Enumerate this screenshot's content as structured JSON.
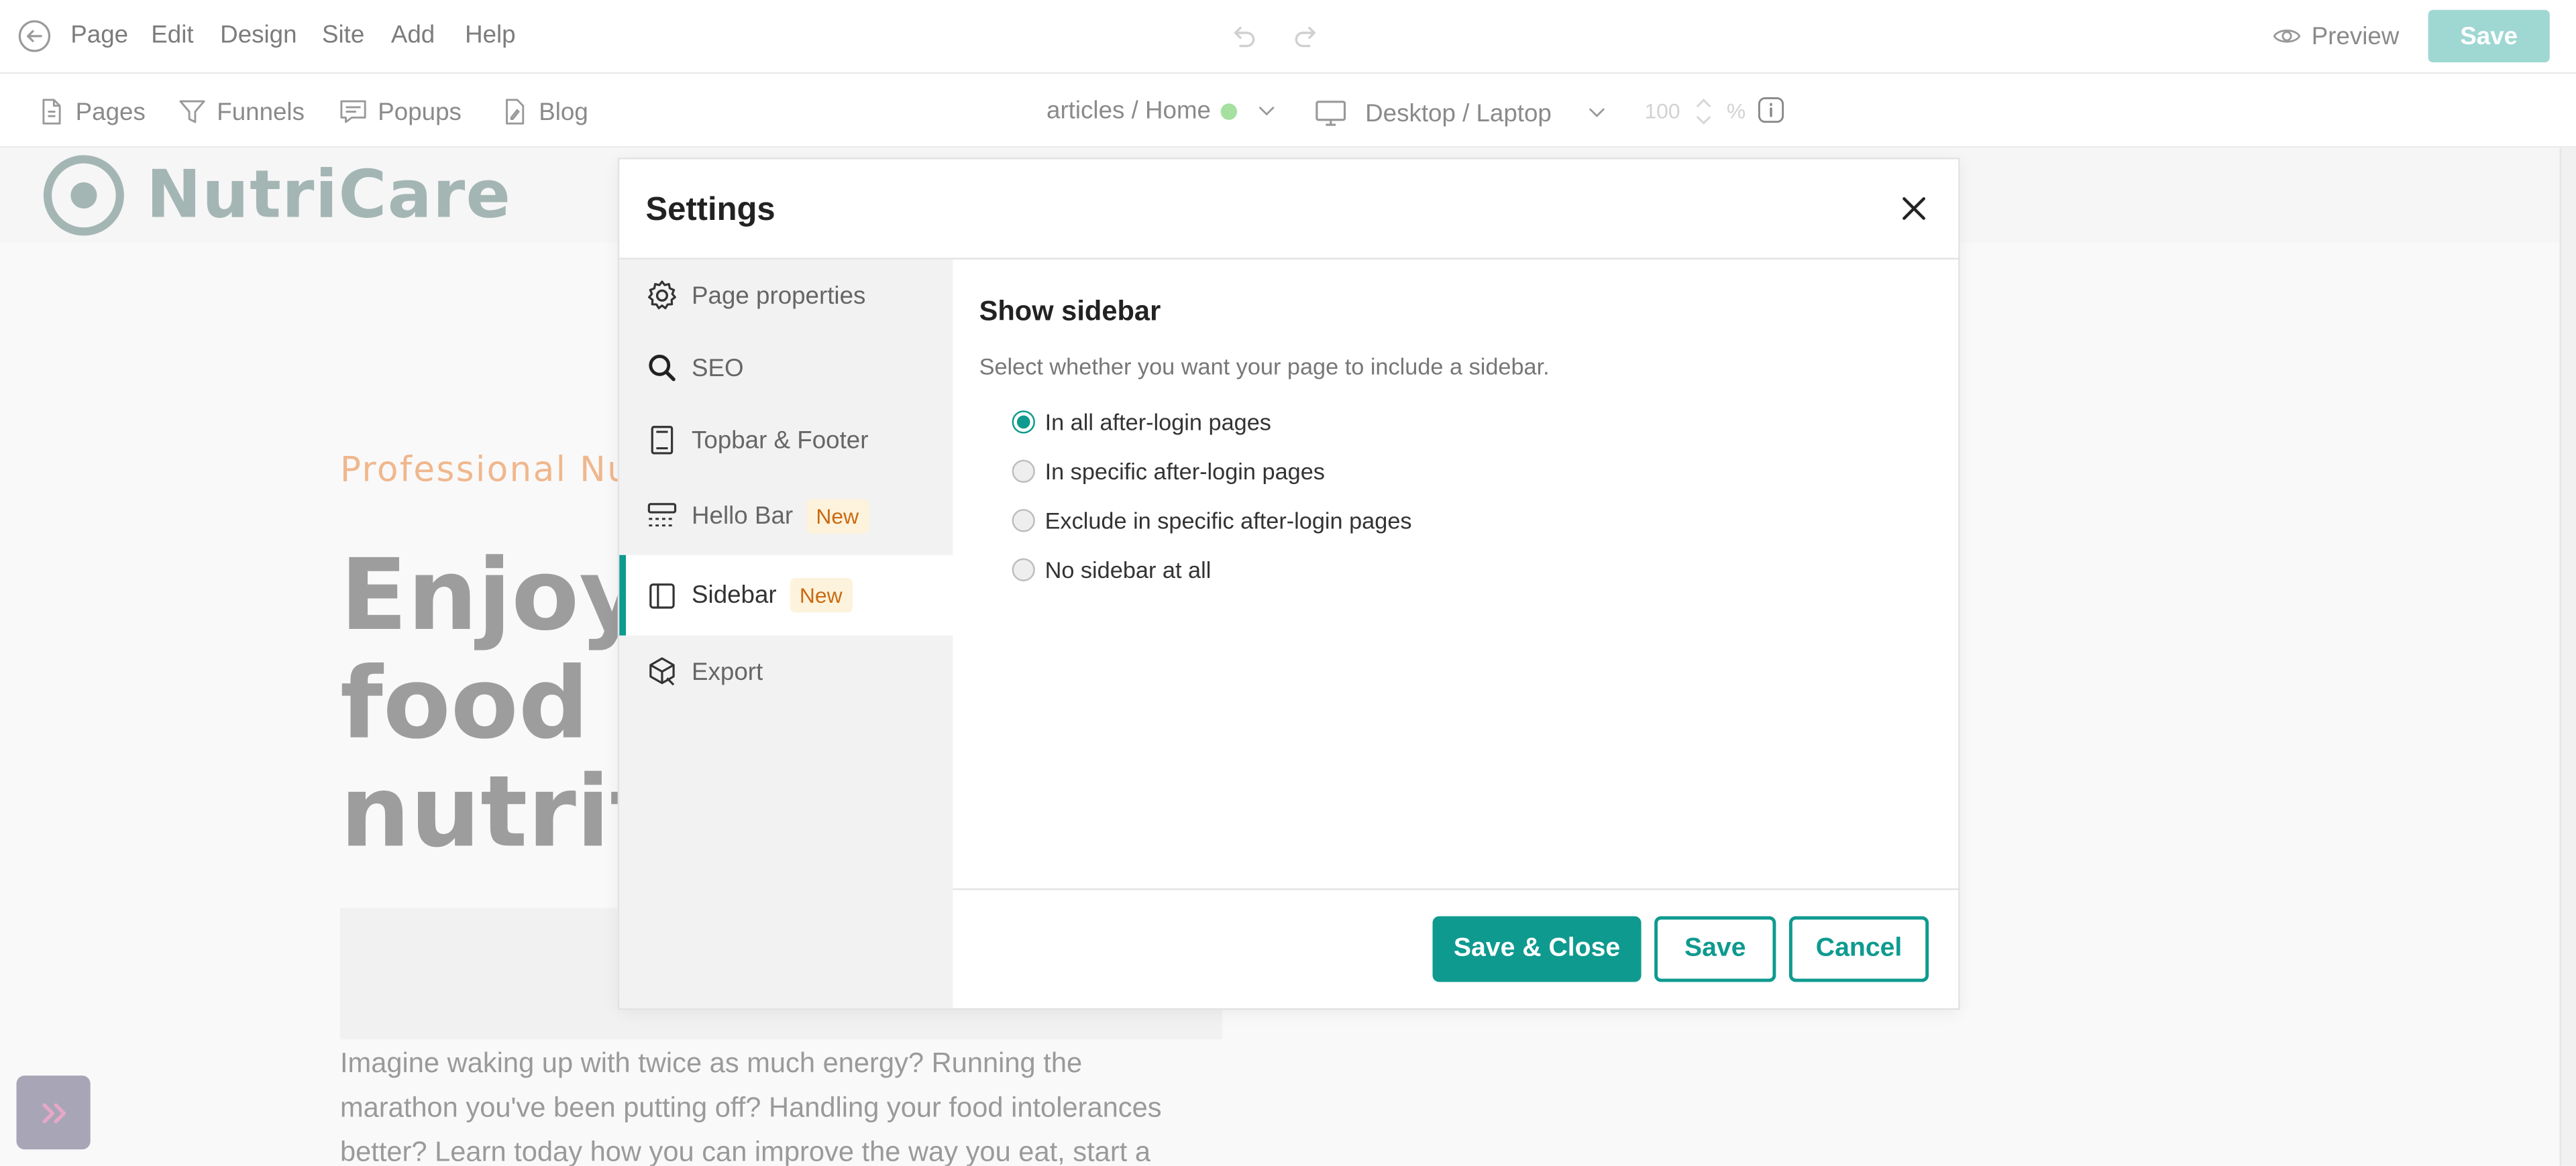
{
  "menu": {
    "items": [
      "Page",
      "Edit",
      "Design",
      "Site",
      "Add",
      "Help"
    ],
    "preview_label": "Preview",
    "save_label": "Save"
  },
  "toolbar": {
    "pages": "Pages",
    "funnels": "Funnels",
    "popups": "Popups",
    "blog": "Blog",
    "page_selector": "articles / Home",
    "device": "Desktop / Laptop",
    "zoom": "100",
    "zoom_unit": "%"
  },
  "background_page": {
    "logo_text": "NutriCare",
    "eyebrow": "Professional Nu",
    "hero_lines": [
      "Enjoy t",
      "food w",
      "nutriti"
    ],
    "body_lines": [
      "Imagine waking up with twice as much energy? Running the",
      "marathon you've been putting off? Handling your food intolerances",
      "better? Learn today how you can improve the way you eat, start a"
    ]
  },
  "modal": {
    "title": "Settings",
    "sidebar": [
      {
        "label": "Page properties",
        "icon": "gear-icon"
      },
      {
        "label": "SEO",
        "icon": "search-icon"
      },
      {
        "label": "Topbar & Footer",
        "icon": "layout-icon"
      },
      {
        "label": "Hello Bar",
        "icon": "hello-bar-icon",
        "badge": "New"
      },
      {
        "label": "Sidebar",
        "icon": "sidebar-icon",
        "badge": "New",
        "active": true
      },
      {
        "label": "Export",
        "icon": "export-icon"
      }
    ],
    "section_title": "Show sidebar",
    "section_desc": "Select whether you want your page to include a sidebar.",
    "options": [
      {
        "label": "In all after-login pages",
        "checked": true
      },
      {
        "label": "In specific after-login pages",
        "checked": false
      },
      {
        "label": "Exclude in specific after-login pages",
        "checked": false
      },
      {
        "label": "No sidebar at all",
        "checked": false
      }
    ],
    "buttons": {
      "save_close": "Save & Close",
      "save": "Save",
      "cancel": "Cancel"
    }
  },
  "colors": {
    "accent": "#0e9a8f",
    "badge_bg": "#fdf3dc",
    "badge_text": "#c96a13",
    "status_dot": "#a5e0a1"
  }
}
